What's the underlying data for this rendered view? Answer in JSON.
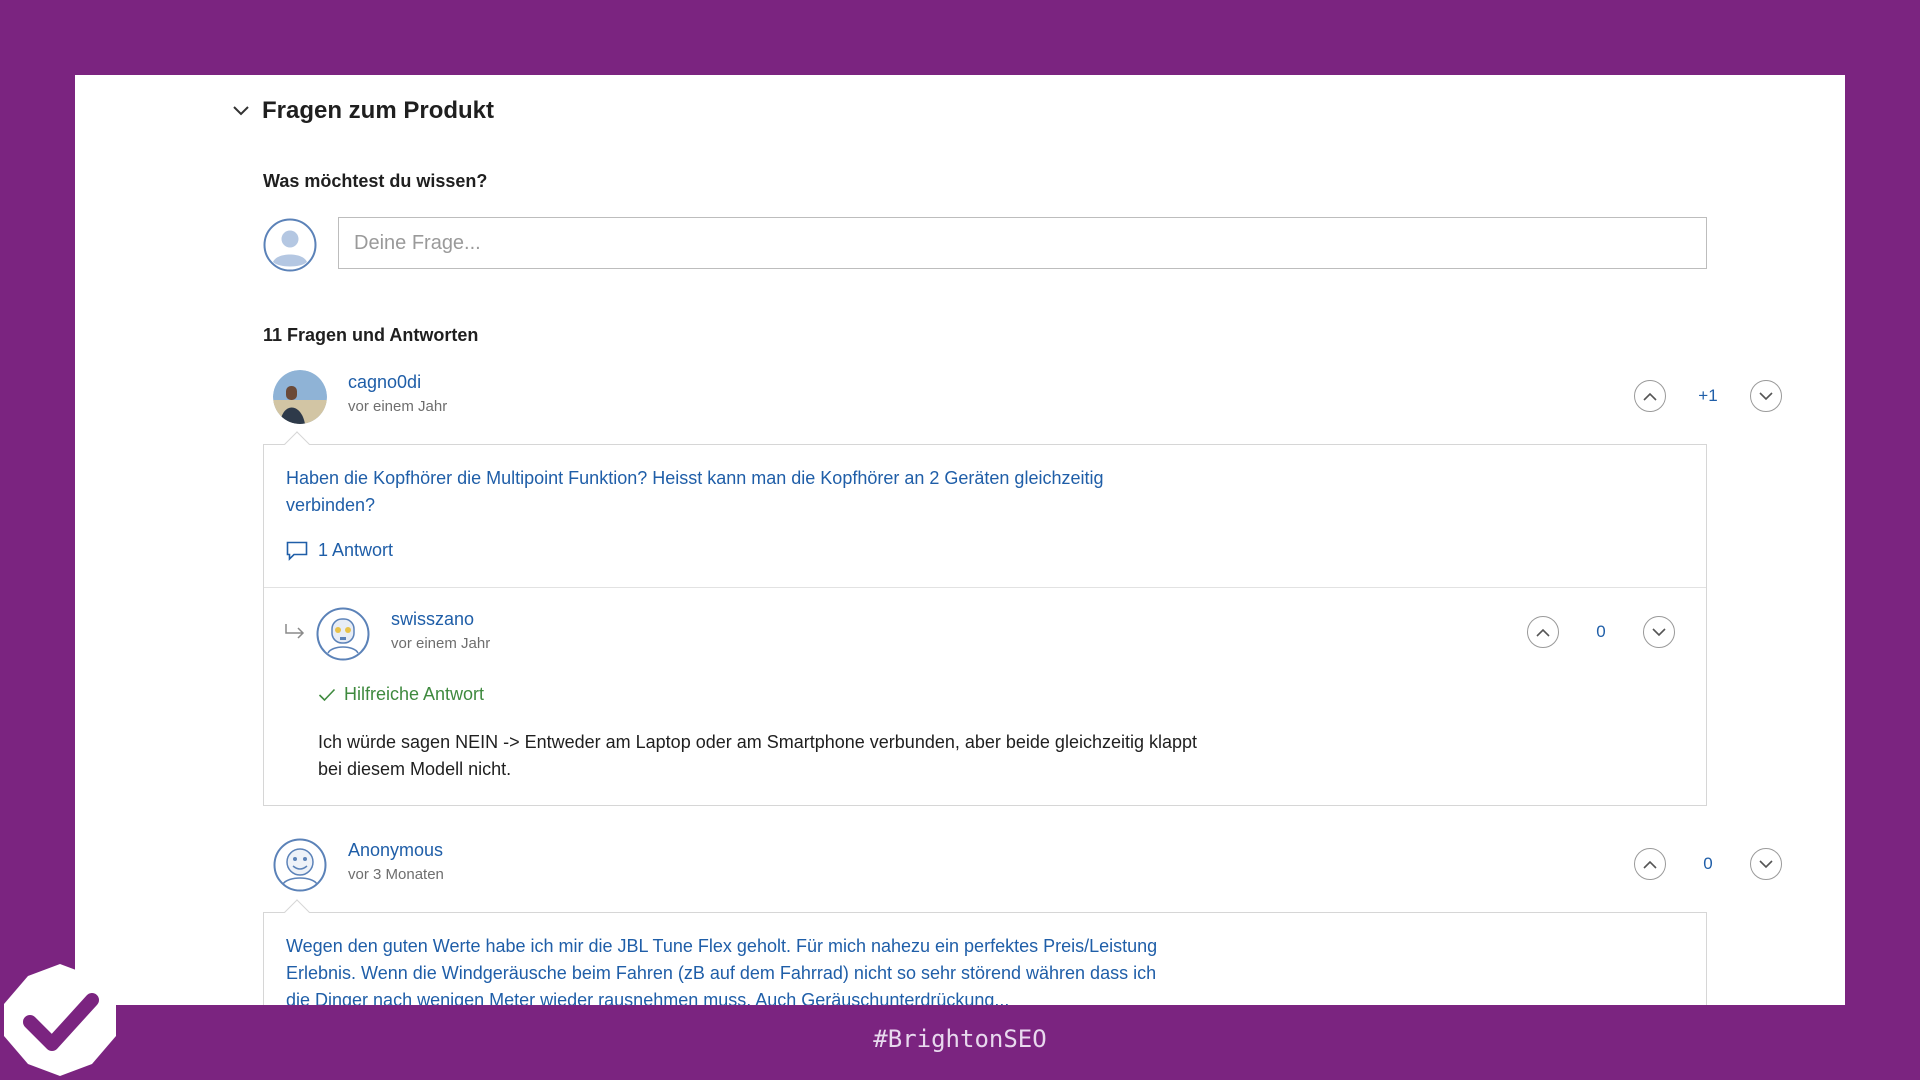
{
  "section": {
    "title": "Fragen zum Produkt"
  },
  "ask": {
    "prompt": "Was möchtest du wissen?",
    "placeholder": "Deine Frage..."
  },
  "qa_count": "11 Fragen und Antworten",
  "questions": [
    {
      "user": "cagno0di",
      "time": "vor einem Jahr",
      "score": "+1",
      "text": "Haben die Kopfhörer die Multipoint Funktion? Heisst kann man die Kopfhörer an 2 Geräten gleichzeitig verbinden?",
      "answers_label": "1 Antwort",
      "answer": {
        "user": "swisszano",
        "time": "vor einem Jahr",
        "score": "0",
        "helpful_label": "Hilfreiche Antwort",
        "text": "Ich würde sagen NEIN -> Entweder am Laptop oder am Smartphone verbunden, aber beide gleichzeitig klappt bei diesem Modell nicht."
      }
    },
    {
      "user": "Anonymous",
      "time": "vor 3 Monaten",
      "score": "0",
      "text": "Wegen den guten Werte habe ich mir die JBL Tune Flex geholt. Für mich nahezu ein perfektes Preis/Leistung Erlebnis. Wenn die Windgeräusche beim Fahren (zB auf dem Fahrrad) nicht so sehr störend währen dass ich die Dinger nach wenigen Meter wieder rausnehmen muss. Auch Geräuschunterdrückung..."
    }
  ],
  "footer": {
    "hashtag": "#BrightonSEO"
  },
  "colors": {
    "background": "#7b2480",
    "link": "#1f5ea8",
    "helpful": "#3f8a3f"
  }
}
